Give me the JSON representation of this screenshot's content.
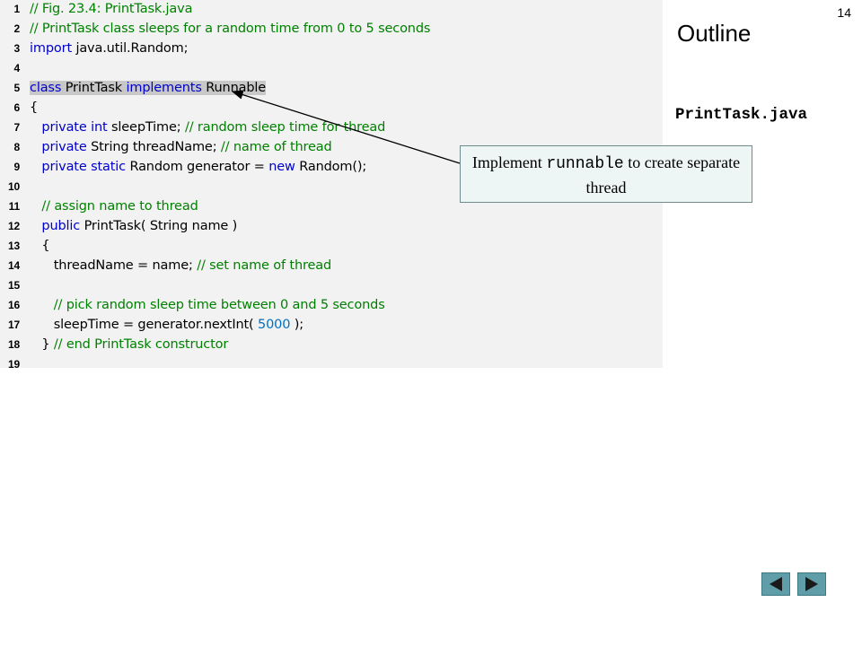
{
  "slide_number": "14",
  "outline": {
    "title": "Outline",
    "file_label": "PrintTask.java"
  },
  "callout": {
    "text_before": "Implement ",
    "code": "runnable",
    "text_after": " to create separate thread"
  },
  "code_lines": [
    {
      "no": "1",
      "tokens": [
        {
          "t": "// Fig. 23.4: PrintTask.java",
          "c": "c"
        }
      ]
    },
    {
      "no": "2",
      "tokens": [
        {
          "t": "// PrintTask class sleeps for a random time from 0 to 5 seconds",
          "c": "c"
        }
      ]
    },
    {
      "no": "3",
      "tokens": [
        {
          "t": "import",
          "c": "k"
        },
        {
          "t": " java.util.Random;",
          "c": "p"
        }
      ]
    },
    {
      "no": "4",
      "tokens": []
    },
    {
      "no": "5",
      "tokens": [
        {
          "t": "class",
          "c": "k",
          "hl": true
        },
        {
          "t": " PrintTask ",
          "c": "p",
          "hl": true
        },
        {
          "t": "implements",
          "c": "k",
          "hl": true
        },
        {
          "t": " Runnable",
          "c": "p",
          "hl": true
        }
      ]
    },
    {
      "no": "6",
      "tokens": [
        {
          "t": "{",
          "c": "p"
        }
      ]
    },
    {
      "no": "7",
      "tokens": [
        {
          "t": "   ",
          "c": "p"
        },
        {
          "t": "private",
          "c": "k"
        },
        {
          "t": " ",
          "c": "p"
        },
        {
          "t": "int",
          "c": "k"
        },
        {
          "t": " sleepTime; ",
          "c": "p"
        },
        {
          "t": "// random sleep time for thread",
          "c": "c"
        }
      ]
    },
    {
      "no": "8",
      "tokens": [
        {
          "t": "   ",
          "c": "p"
        },
        {
          "t": "private",
          "c": "k"
        },
        {
          "t": " String threadName; ",
          "c": "p"
        },
        {
          "t": "// name of thread",
          "c": "c"
        }
      ]
    },
    {
      "no": "9",
      "tokens": [
        {
          "t": "   ",
          "c": "p"
        },
        {
          "t": "private",
          "c": "k"
        },
        {
          "t": " ",
          "c": "p"
        },
        {
          "t": "static",
          "c": "k"
        },
        {
          "t": " Random generator = ",
          "c": "p"
        },
        {
          "t": "new",
          "c": "k"
        },
        {
          "t": " Random();",
          "c": "p"
        }
      ]
    },
    {
      "no": "10",
      "tokens": []
    },
    {
      "no": "11",
      "tokens": [
        {
          "t": "   ",
          "c": "p"
        },
        {
          "t": "// assign name to thread",
          "c": "c"
        }
      ]
    },
    {
      "no": "12",
      "tokens": [
        {
          "t": "   ",
          "c": "p"
        },
        {
          "t": "public",
          "c": "k"
        },
        {
          "t": " PrintTask( String name )",
          "c": "p"
        }
      ]
    },
    {
      "no": "13",
      "tokens": [
        {
          "t": "   {",
          "c": "p"
        }
      ]
    },
    {
      "no": "14",
      "tokens": [
        {
          "t": "      threadName = name; ",
          "c": "p"
        },
        {
          "t": "// set name of thread",
          "c": "c"
        }
      ]
    },
    {
      "no": "15",
      "tokens": []
    },
    {
      "no": "16",
      "tokens": [
        {
          "t": "      ",
          "c": "p"
        },
        {
          "t": "// pick random sleep time between 0 and 5 seconds",
          "c": "c"
        }
      ]
    },
    {
      "no": "17",
      "tokens": [
        {
          "t": "      sleepTime = generator.nextInt( ",
          "c": "p"
        },
        {
          "t": "5000",
          "c": "n"
        },
        {
          "t": " );",
          "c": "p"
        }
      ]
    },
    {
      "no": "18",
      "tokens": [
        {
          "t": "   } ",
          "c": "p"
        },
        {
          "t": "// end PrintTask constructor",
          "c": "c"
        }
      ]
    },
    {
      "no": "19",
      "tokens": []
    }
  ],
  "colors": {
    "comment": "#008000",
    "keyword": "#0000cc",
    "number": "#0070c0",
    "panel_background": "#f2f2f2",
    "nav_button": "#5f9ea8"
  },
  "nav": {
    "prev_icon": "triangle-left-icon",
    "next_icon": "triangle-right-icon"
  }
}
